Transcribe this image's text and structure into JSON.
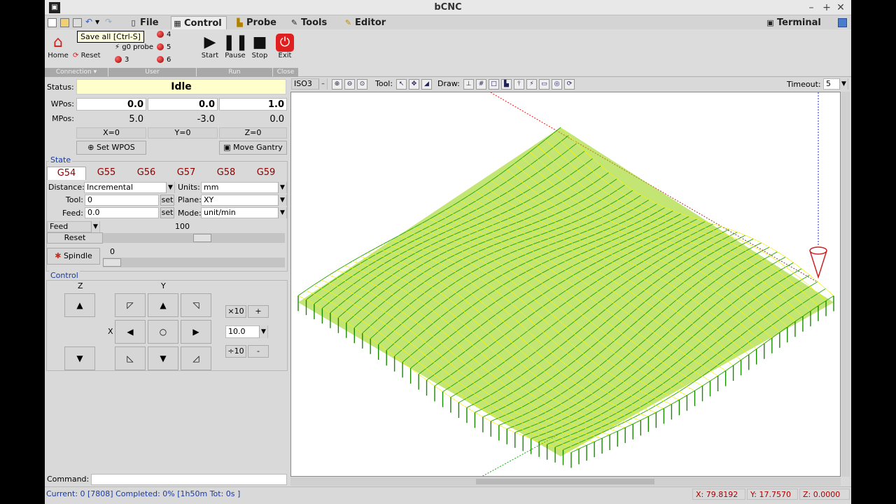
{
  "window": {
    "title": "bCNC"
  },
  "menu": {
    "tabs": [
      {
        "label": "File"
      },
      {
        "label": "Control"
      },
      {
        "label": "Probe"
      },
      {
        "label": "Tools"
      },
      {
        "label": "Editor"
      }
    ],
    "terminal": "Terminal"
  },
  "tooltip": "Save all [Ctrl-S]",
  "ribbon": {
    "home": "Home",
    "reset": "Reset",
    "connection": "Connection",
    "user": "User",
    "user_items": [
      "g0 probe",
      "3",
      "4",
      "5",
      "6"
    ],
    "run": "Run",
    "start": "Start",
    "pause": "Pause",
    "stop": "Stop",
    "close": "Close",
    "exit": "Exit"
  },
  "dro": {
    "status_label": "Status:",
    "status": "Idle",
    "wpos_label": "WPos:",
    "mpos_label": "MPos:",
    "wpos": [
      "0.0",
      "0.0",
      "1.0"
    ],
    "mpos": [
      "5.0",
      "-3.0",
      "0.0"
    ],
    "zero": [
      "X=0",
      "Y=0",
      "Z=0"
    ],
    "set_wpos": "Set WPOS",
    "move_gantry": "Move Gantry"
  },
  "state": {
    "title": "State",
    "gcodes": [
      "G54",
      "G55",
      "G56",
      "G57",
      "G58",
      "G59"
    ],
    "distance_label": "Distance:",
    "distance": "Incremental",
    "units_label": "Units:",
    "units": "mm",
    "tool_label": "Tool:",
    "tool": "0",
    "plane_label": "Plane:",
    "plane": "XY",
    "feed_label": "Feed:",
    "feed": "0.0",
    "mode_label": "Mode:",
    "mode": "unit/min",
    "set": "set",
    "override": "Feed",
    "override_value": "100",
    "override_fraction": 0.55,
    "reset": "Reset",
    "spindle": "Spindle",
    "spindle_value": "0",
    "spindle_fraction": 0.0
  },
  "control": {
    "title": "Control",
    "z": "Z",
    "y": "Y",
    "x": "X",
    "x10": "×10",
    "plus": "+",
    "step": "10.0",
    "d10": "÷10",
    "minus": "-"
  },
  "viewer": {
    "view": "ISO3",
    "tool_label": "Tool:",
    "draw_label": "Draw:",
    "timeout_label": "Timeout:",
    "timeout": "5"
  },
  "command_label": "Command:",
  "status": {
    "text": "Current: 0 [7808]  Completed: 0% [1h50m Tot: 0s ]",
    "x": "X: 79.8192",
    "y": "Y: 17.7570",
    "z": "Z: 0.0000"
  },
  "colors": {
    "mesh": "#22a500",
    "mesh_yellow": "#f5f500",
    "accent": "#1a3aa0",
    "gcode_red": "#8b0000"
  }
}
